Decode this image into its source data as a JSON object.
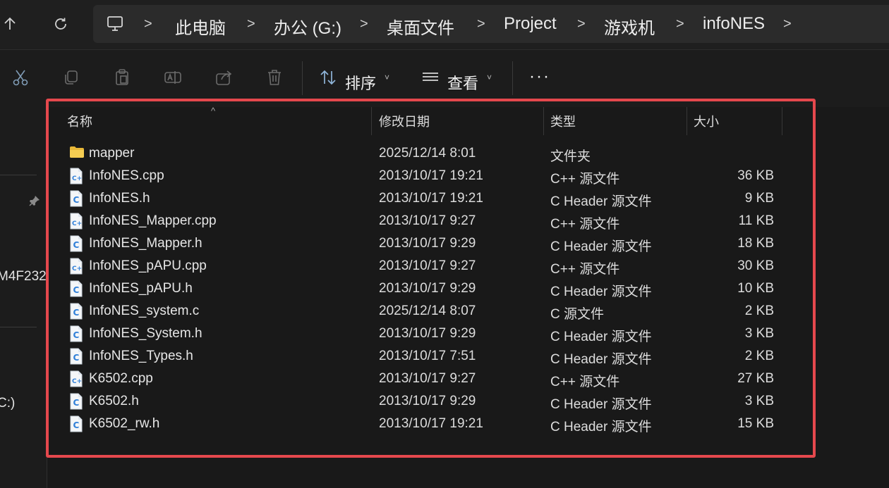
{
  "address_bar": {
    "crumbs": [
      "此电脑",
      "办公 (G:)",
      "桌面文件",
      "Project",
      "游戏机",
      "infoNES"
    ]
  },
  "toolbar": {
    "sort_label": "排序",
    "view_label": "查看",
    "more_label": "···"
  },
  "sidebar": {
    "partial_item_1": "M4F232",
    "partial_item_2": "C:)"
  },
  "columns": {
    "name": "名称",
    "date": "修改日期",
    "type": "类型",
    "size": "大小"
  },
  "files": [
    {
      "name": "mapper",
      "date": "2025/12/14 8:01",
      "type": "文件夹",
      "size": "",
      "icon": "folder-icon"
    },
    {
      "name": "InfoNES.cpp",
      "date": "2013/10/17 19:21",
      "type": "C++ 源文件",
      "size": "36 KB",
      "icon": "cpp-file-icon"
    },
    {
      "name": "InfoNES.h",
      "date": "2013/10/17 19:21",
      "type": "C Header 源文件",
      "size": "9 KB",
      "icon": "c-file-icon"
    },
    {
      "name": "InfoNES_Mapper.cpp",
      "date": "2013/10/17 9:27",
      "type": "C++ 源文件",
      "size": "11 KB",
      "icon": "cpp-file-icon"
    },
    {
      "name": "InfoNES_Mapper.h",
      "date": "2013/10/17 9:29",
      "type": "C Header 源文件",
      "size": "18 KB",
      "icon": "c-file-icon"
    },
    {
      "name": "InfoNES_pAPU.cpp",
      "date": "2013/10/17 9:27",
      "type": "C++ 源文件",
      "size": "30 KB",
      "icon": "cpp-file-icon"
    },
    {
      "name": "InfoNES_pAPU.h",
      "date": "2013/10/17 9:29",
      "type": "C Header 源文件",
      "size": "10 KB",
      "icon": "c-file-icon"
    },
    {
      "name": "InfoNES_system.c",
      "date": "2025/12/14 8:07",
      "type": "C 源文件",
      "size": "2 KB",
      "icon": "c-file-icon"
    },
    {
      "name": "InfoNES_System.h",
      "date": "2013/10/17 9:29",
      "type": "C Header 源文件",
      "size": "3 KB",
      "icon": "c-file-icon"
    },
    {
      "name": "InfoNES_Types.h",
      "date": "2013/10/17 7:51",
      "type": "C Header 源文件",
      "size": "2 KB",
      "icon": "c-file-icon"
    },
    {
      "name": "K6502.cpp",
      "date": "2013/10/17 9:27",
      "type": "C++ 源文件",
      "size": "27 KB",
      "icon": "cpp-file-icon"
    },
    {
      "name": "K6502.h",
      "date": "2013/10/17 9:29",
      "type": "C Header 源文件",
      "size": "3 KB",
      "icon": "c-file-icon"
    },
    {
      "name": "K6502_rw.h",
      "date": "2013/10/17 19:21",
      "type": "C Header 源文件",
      "size": "15 KB",
      "icon": "c-file-icon"
    }
  ],
  "colors": {
    "highlight_border": "#e5484d",
    "folder": "#f2c94c",
    "file_icon_accent": "#2f7fd8"
  }
}
